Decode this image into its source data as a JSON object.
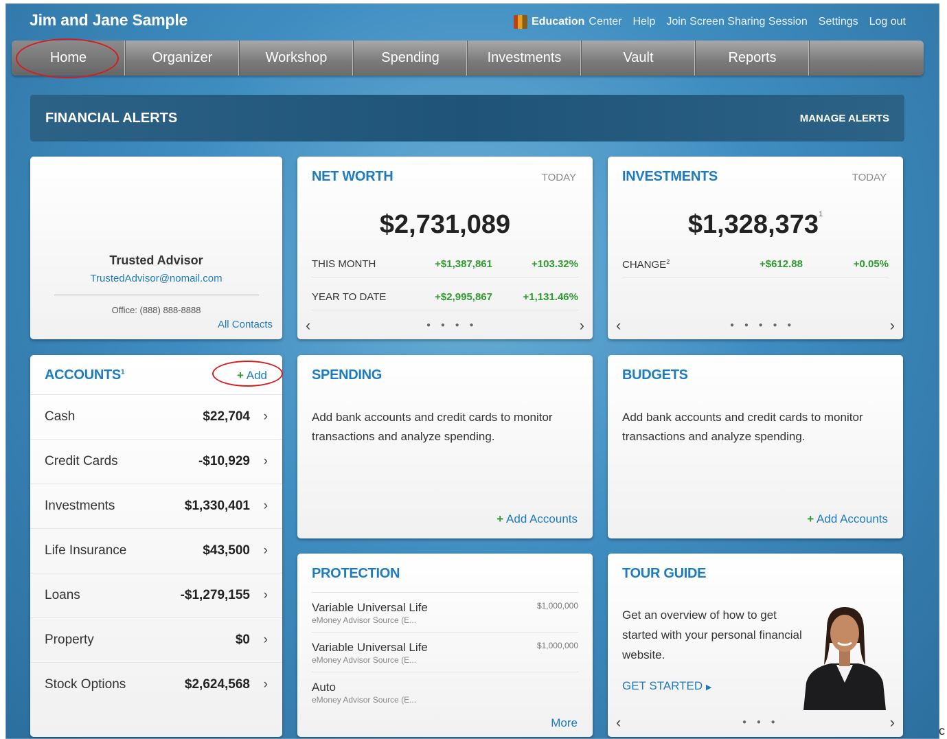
{
  "header": {
    "user_name": "Jim and Jane Sample",
    "links": {
      "education_bold": "Education",
      "education_rest": "Center",
      "help": "Help",
      "screen_sharing": "Join Screen Sharing Session",
      "settings": "Settings",
      "logout": "Log out"
    }
  },
  "nav": {
    "items": [
      "Home",
      "Organizer",
      "Workshop",
      "Spending",
      "Investments",
      "Vault",
      "Reports"
    ],
    "active": "Home"
  },
  "alerts": {
    "title": "FINANCIAL ALERTS",
    "manage": "MANAGE ALERTS"
  },
  "advisor": {
    "name": "Trusted Advisor",
    "email": "TrustedAdvisor@nomail.com",
    "office": "Office: (888) 888-8888",
    "all_contacts": "All Contacts"
  },
  "net_worth": {
    "title": "NET WORTH",
    "period": "TODAY",
    "value": "$2,731,089",
    "rows": [
      {
        "label": "THIS MONTH",
        "amount": "+$1,387,861",
        "pct": "+103.32%"
      },
      {
        "label": "YEAR TO DATE",
        "amount": "+$2,995,867",
        "pct": "+1,131.46%"
      }
    ]
  },
  "investments": {
    "title": "INVESTMENTS",
    "period": "TODAY",
    "value": "$1,328,373",
    "footnote": "1",
    "change_label": "CHANGE",
    "change_sup": "2",
    "change_amount": "+$612.88",
    "change_pct": "+0.05%"
  },
  "accounts": {
    "title": "ACCOUNTS",
    "title_sup": "1",
    "add_label": "Add",
    "rows": [
      {
        "name": "Cash",
        "amount": "$22,704"
      },
      {
        "name": "Credit Cards",
        "amount": "-$10,929"
      },
      {
        "name": "Investments",
        "amount": "$1,330,401"
      },
      {
        "name": "Life Insurance",
        "amount": "$43,500"
      },
      {
        "name": "Loans",
        "amount": "-$1,279,155"
      },
      {
        "name": "Property",
        "amount": "$0"
      },
      {
        "name": "Stock Options",
        "amount": "$2,624,568"
      }
    ]
  },
  "spending": {
    "title": "SPENDING",
    "text": "Add bank accounts and credit cards to monitor transactions and analyze spending.",
    "action": "Add Accounts"
  },
  "budgets": {
    "title": "BUDGETS",
    "text": "Add bank accounts and credit cards to monitor transactions and analyze spending.",
    "action": "Add Accounts"
  },
  "protection": {
    "title": "PROTECTION",
    "policies": [
      {
        "name": "Variable Universal Life",
        "source": "eMoney Advisor Source (E...",
        "amount": "$1,000,000"
      },
      {
        "name": "Variable Universal Life",
        "source": "eMoney Advisor Source (E...",
        "amount": "$1,000,000"
      },
      {
        "name": "Auto",
        "source": "eMoney Advisor Source (E...",
        "amount": ""
      }
    ],
    "more": "More"
  },
  "tour": {
    "title": "TOUR GUIDE",
    "text": "Get an overview of how to get started with your personal financial website.",
    "action": "GET STARTED"
  },
  "edge_text": "c",
  "colors": {
    "accent_blue": "#1d7cc0",
    "positive_green": "#2e9b2e",
    "highlight_red": "#d81c1c"
  }
}
